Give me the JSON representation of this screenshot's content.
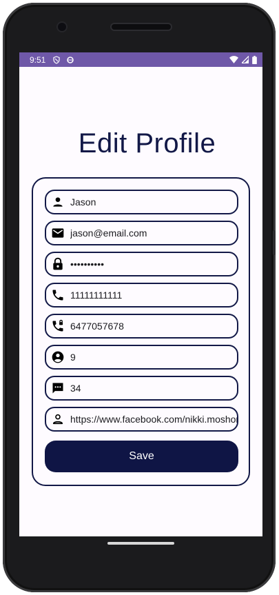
{
  "status_bar": {
    "time": "9:51",
    "icons": [
      "shield-icon",
      "data-saver-icon",
      "wifi-icon",
      "signal-icon",
      "battery-icon"
    ]
  },
  "page": {
    "title": "Edit Profile"
  },
  "form": {
    "fields": [
      {
        "name": "name",
        "icon": "person-icon",
        "value": "Jason"
      },
      {
        "name": "email",
        "icon": "mail-icon",
        "value": "jason@email.com"
      },
      {
        "name": "password",
        "icon": "lock-icon",
        "value": "••••••••••"
      },
      {
        "name": "phone",
        "icon": "phone-icon",
        "value": "11111111111"
      },
      {
        "name": "emergency-phone",
        "icon": "phone-lock-icon",
        "value": "6477057678"
      },
      {
        "name": "account",
        "icon": "account-circle-icon",
        "value": "9"
      },
      {
        "name": "message",
        "icon": "chat-icon",
        "value": "34"
      },
      {
        "name": "profile-link",
        "icon": "person-outline-icon",
        "value": "https://www.facebook.com/nikki.moshor"
      }
    ],
    "save_label": "Save"
  },
  "colors": {
    "status_bar": "#6f58a8",
    "accent": "#121847",
    "button": "#0f1545",
    "background": "#fefbff"
  }
}
